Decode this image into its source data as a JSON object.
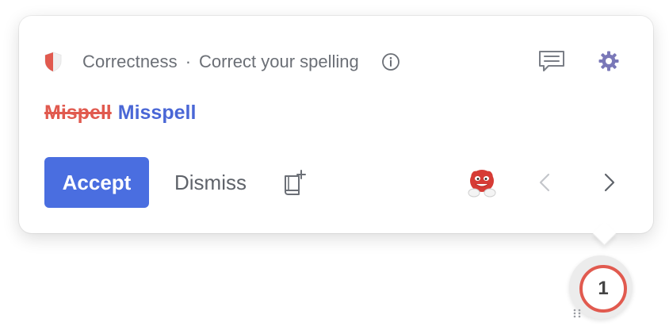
{
  "alert": {
    "category": "Correctness",
    "separator": "·",
    "subtitle": "Correct your spelling"
  },
  "suggestion": {
    "original": "Mispell",
    "replacement": "Misspell"
  },
  "actions": {
    "accept_label": "Accept",
    "dismiss_label": "Dismiss"
  },
  "badge": {
    "count": "1"
  },
  "icons": {
    "category": "shield-icon",
    "info": "info-icon",
    "feedback": "comment-icon",
    "settings": "gear-icon",
    "add_to_dictionary": "add-to-dictionary-icon",
    "assistant": "mascot-icon",
    "previous": "chevron-left-icon",
    "next": "chevron-right-icon"
  },
  "colors": {
    "accent": "#4a6ee0",
    "error": "#e15a4f",
    "replacement": "#4a67d6",
    "muted_text": "#6b6f76"
  }
}
